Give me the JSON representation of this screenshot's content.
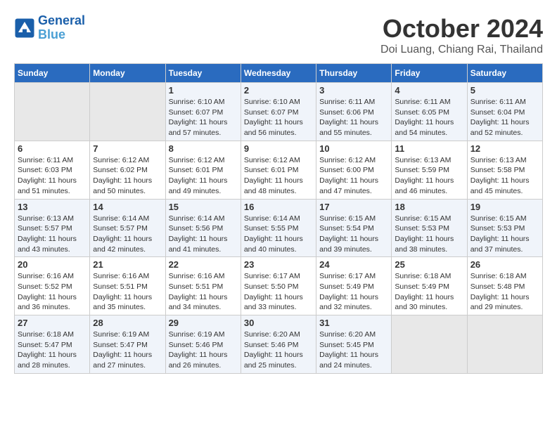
{
  "header": {
    "logo_line1": "General",
    "logo_line2": "Blue",
    "month": "October 2024",
    "location": "Doi Luang, Chiang Rai, Thailand"
  },
  "weekdays": [
    "Sunday",
    "Monday",
    "Tuesday",
    "Wednesday",
    "Thursday",
    "Friday",
    "Saturday"
  ],
  "weeks": [
    [
      {
        "day": "",
        "info": ""
      },
      {
        "day": "",
        "info": ""
      },
      {
        "day": "1",
        "info": "Sunrise: 6:10 AM\nSunset: 6:07 PM\nDaylight: 11 hours and 57 minutes."
      },
      {
        "day": "2",
        "info": "Sunrise: 6:10 AM\nSunset: 6:07 PM\nDaylight: 11 hours and 56 minutes."
      },
      {
        "day": "3",
        "info": "Sunrise: 6:11 AM\nSunset: 6:06 PM\nDaylight: 11 hours and 55 minutes."
      },
      {
        "day": "4",
        "info": "Sunrise: 6:11 AM\nSunset: 6:05 PM\nDaylight: 11 hours and 54 minutes."
      },
      {
        "day": "5",
        "info": "Sunrise: 6:11 AM\nSunset: 6:04 PM\nDaylight: 11 hours and 52 minutes."
      }
    ],
    [
      {
        "day": "6",
        "info": "Sunrise: 6:11 AM\nSunset: 6:03 PM\nDaylight: 11 hours and 51 minutes."
      },
      {
        "day": "7",
        "info": "Sunrise: 6:12 AM\nSunset: 6:02 PM\nDaylight: 11 hours and 50 minutes."
      },
      {
        "day": "8",
        "info": "Sunrise: 6:12 AM\nSunset: 6:01 PM\nDaylight: 11 hours and 49 minutes."
      },
      {
        "day": "9",
        "info": "Sunrise: 6:12 AM\nSunset: 6:01 PM\nDaylight: 11 hours and 48 minutes."
      },
      {
        "day": "10",
        "info": "Sunrise: 6:12 AM\nSunset: 6:00 PM\nDaylight: 11 hours and 47 minutes."
      },
      {
        "day": "11",
        "info": "Sunrise: 6:13 AM\nSunset: 5:59 PM\nDaylight: 11 hours and 46 minutes."
      },
      {
        "day": "12",
        "info": "Sunrise: 6:13 AM\nSunset: 5:58 PM\nDaylight: 11 hours and 45 minutes."
      }
    ],
    [
      {
        "day": "13",
        "info": "Sunrise: 6:13 AM\nSunset: 5:57 PM\nDaylight: 11 hours and 43 minutes."
      },
      {
        "day": "14",
        "info": "Sunrise: 6:14 AM\nSunset: 5:57 PM\nDaylight: 11 hours and 42 minutes."
      },
      {
        "day": "15",
        "info": "Sunrise: 6:14 AM\nSunset: 5:56 PM\nDaylight: 11 hours and 41 minutes."
      },
      {
        "day": "16",
        "info": "Sunrise: 6:14 AM\nSunset: 5:55 PM\nDaylight: 11 hours and 40 minutes."
      },
      {
        "day": "17",
        "info": "Sunrise: 6:15 AM\nSunset: 5:54 PM\nDaylight: 11 hours and 39 minutes."
      },
      {
        "day": "18",
        "info": "Sunrise: 6:15 AM\nSunset: 5:53 PM\nDaylight: 11 hours and 38 minutes."
      },
      {
        "day": "19",
        "info": "Sunrise: 6:15 AM\nSunset: 5:53 PM\nDaylight: 11 hours and 37 minutes."
      }
    ],
    [
      {
        "day": "20",
        "info": "Sunrise: 6:16 AM\nSunset: 5:52 PM\nDaylight: 11 hours and 36 minutes."
      },
      {
        "day": "21",
        "info": "Sunrise: 6:16 AM\nSunset: 5:51 PM\nDaylight: 11 hours and 35 minutes."
      },
      {
        "day": "22",
        "info": "Sunrise: 6:16 AM\nSunset: 5:51 PM\nDaylight: 11 hours and 34 minutes."
      },
      {
        "day": "23",
        "info": "Sunrise: 6:17 AM\nSunset: 5:50 PM\nDaylight: 11 hours and 33 minutes."
      },
      {
        "day": "24",
        "info": "Sunrise: 6:17 AM\nSunset: 5:49 PM\nDaylight: 11 hours and 32 minutes."
      },
      {
        "day": "25",
        "info": "Sunrise: 6:18 AM\nSunset: 5:49 PM\nDaylight: 11 hours and 30 minutes."
      },
      {
        "day": "26",
        "info": "Sunrise: 6:18 AM\nSunset: 5:48 PM\nDaylight: 11 hours and 29 minutes."
      }
    ],
    [
      {
        "day": "27",
        "info": "Sunrise: 6:18 AM\nSunset: 5:47 PM\nDaylight: 11 hours and 28 minutes."
      },
      {
        "day": "28",
        "info": "Sunrise: 6:19 AM\nSunset: 5:47 PM\nDaylight: 11 hours and 27 minutes."
      },
      {
        "day": "29",
        "info": "Sunrise: 6:19 AM\nSunset: 5:46 PM\nDaylight: 11 hours and 26 minutes."
      },
      {
        "day": "30",
        "info": "Sunrise: 6:20 AM\nSunset: 5:46 PM\nDaylight: 11 hours and 25 minutes."
      },
      {
        "day": "31",
        "info": "Sunrise: 6:20 AM\nSunset: 5:45 PM\nDaylight: 11 hours and 24 minutes."
      },
      {
        "day": "",
        "info": ""
      },
      {
        "day": "",
        "info": ""
      }
    ]
  ]
}
